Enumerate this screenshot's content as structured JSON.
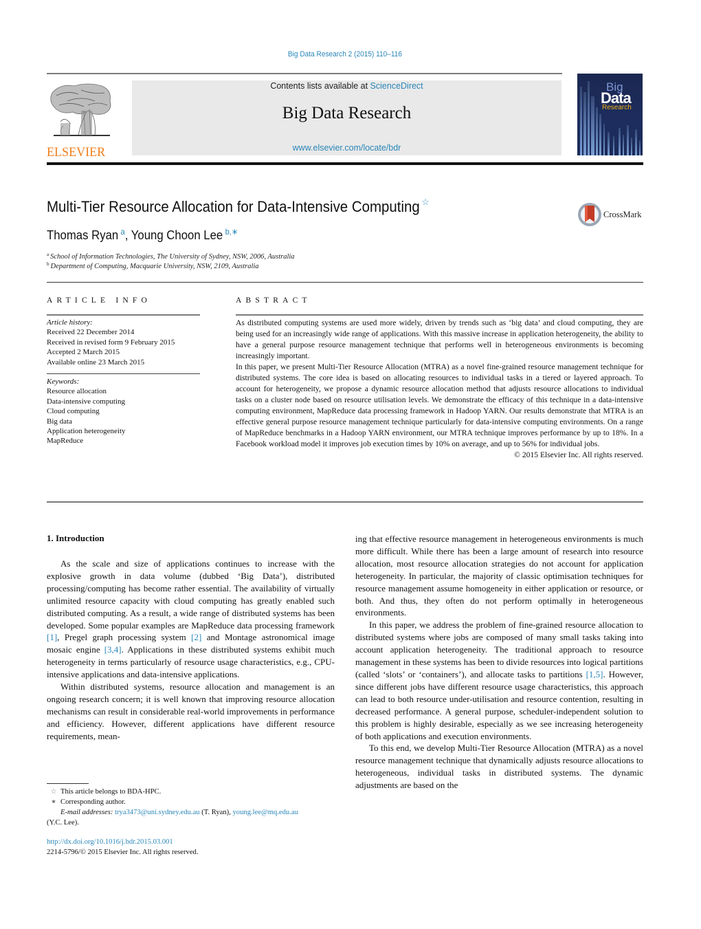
{
  "header": {
    "journal_ref": "Big Data Research 2 (2015) 110–116",
    "contents_prefix": "Contents lists available at ",
    "contents_link": "ScienceDirect",
    "journal_title": "Big Data Research",
    "journal_url": "www.elsevier.com/locate/bdr",
    "publisher_logo_text": "ELSEVIER",
    "cover": {
      "big": "Big",
      "data": "Data",
      "research": "Research"
    },
    "colors": {
      "link": "#2a86b8",
      "elsevier_orange": "#f07e1b",
      "masthead_bg": "#e9e9e9",
      "cover_bg": "#1b2850",
      "cover_accent": "#f2b21a"
    }
  },
  "article": {
    "title": "Multi-Tier Resource Allocation for Data-Intensive Computing",
    "title_note_mark": "☆",
    "crossmark_label": "CrossMark",
    "authors": [
      {
        "name": "Thomas Ryan",
        "sup": "a"
      },
      {
        "name": "Young Choon Lee",
        "sup": "b,∗"
      }
    ],
    "author_separator": ", ",
    "affiliations": [
      {
        "mark": "a",
        "text": "School of Information Technologies, The University of Sydney, NSW, 2006, Australia"
      },
      {
        "mark": "b",
        "text": "Department of Computing, Macquarie University, NSW, 2109, Australia"
      }
    ]
  },
  "article_info": {
    "heading": "ARTICLE INFO",
    "history_label": "Article history:",
    "history": [
      "Received 22 December 2014",
      "Received in revised form 9 February 2015",
      "Accepted 2 March 2015",
      "Available online 23 March 2015"
    ],
    "keywords_label": "Keywords:",
    "keywords": [
      "Resource allocation",
      "Data-intensive computing",
      "Cloud computing",
      "Big data",
      "Application heterogeneity",
      "MapReduce"
    ]
  },
  "abstract": {
    "heading": "ABSTRACT",
    "paragraphs": [
      "As distributed computing systems are used more widely, driven by trends such as ‘big data’ and cloud computing, they are being used for an increasingly wide range of applications. With this massive increase in application heterogeneity, the ability to have a general purpose resource management technique that performs well in heterogeneous environments is becoming increasingly important.",
      "In this paper, we present Multi-Tier Resource Allocation (MTRA) as a novel fine-grained resource management technique for distributed systems. The core idea is based on allocating resources to individual tasks in a tiered or layered approach. To account for heterogeneity, we propose a dynamic resource allocation method that adjusts resource allocations to individual tasks on a cluster node based on resource utilisation levels. We demonstrate the efficacy of this technique in a data-intensive computing environment, MapReduce data processing framework in Hadoop YARN. Our results demonstrate that MTRA is an effective general purpose resource management technique particularly for data-intensive computing environments. On a range of MapReduce benchmarks in a Hadoop YARN environment, our MTRA technique improves performance by up to 18%. In a Facebook workload model it improves job execution times by 10% on average, and up to 56% for individual jobs."
    ],
    "copyright": "© 2015 Elsevier Inc. All rights reserved."
  },
  "body": {
    "section_heading": "1.  Introduction",
    "left": [
      {
        "parts": [
          {
            "t": "As the scale and size of applications continues to increase with the explosive growth in data volume (dubbed ‘Big Data’), distributed processing/computing has become rather essential. The availability of virtually unlimited resource capacity with cloud computing has greatly enabled such distributed computing. As a result, a wide range of distributed systems has been developed. Some popular examples are MapReduce data processing framework "
          },
          {
            "ref": "[1]"
          },
          {
            "t": ", Pregel graph processing system "
          },
          {
            "ref": "[2]"
          },
          {
            "t": " and Montage astronomical image mosaic engine "
          },
          {
            "ref": "[3,4]"
          },
          {
            "t": ". Applications in these distributed systems exhibit much heterogeneity in terms particularly of resource usage characteristics, e.g., CPU-intensive applications and data-intensive applications."
          }
        ]
      },
      {
        "parts": [
          {
            "t": "Within distributed systems, resource allocation and management is an ongoing research concern; it is well known that improving resource allocation mechanisms can result in considerable real-world improvements in performance and efficiency. However, different applications have different resource requirements, mean-"
          }
        ]
      }
    ],
    "right": [
      {
        "noindent": true,
        "parts": [
          {
            "t": "ing that effective resource management in heterogeneous environments is much more difficult. While there has been a large amount of research into resource allocation, most resource allocation strategies do not account for application heterogeneity. In particular, the majority of classic optimisation techniques for resource management assume homogeneity in either application or resource, or both. And thus, they often do not perform optimally in heterogeneous environments."
          }
        ]
      },
      {
        "parts": [
          {
            "t": "In this paper, we address the problem of fine-grained resource allocation to distributed systems where jobs are composed of many small tasks taking into account application heterogeneity. The traditional approach to resource management in these systems has been to divide resources into logical partitions (called ‘slots’ or ‘containers’), and allocate tasks to partitions "
          },
          {
            "ref": "[1,5]"
          },
          {
            "t": ". However, since different jobs have different resource usage characteristics, this approach can lead to both resource under-utilisation and resource contention, resulting in decreased performance. A general purpose, scheduler-independent solution to this problem is highly desirable, especially as we see increasing heterogeneity of both applications and execution environments."
          }
        ]
      },
      {
        "parts": [
          {
            "t": "To this end, we develop Multi-Tier Resource Allocation (MTRA) as a novel resource management technique that dynamically adjusts resource allocations to heterogeneous, individual tasks in distributed systems. The dynamic adjustments are based on the"
          }
        ]
      }
    ]
  },
  "footnotes": {
    "star_mark": "☆",
    "star_text": "This article belongs to BDA-HPC.",
    "corr_mark": "∗",
    "corr_text": "Corresponding author.",
    "email_label": "E-mail addresses:",
    "email1": "trya3473@uni.sydney.edu.au",
    "email1_owner": " (T. Ryan), ",
    "email2": "young.lee@mq.edu.au",
    "email2_owner": "(Y.C. Lee).",
    "doi": "http://dx.doi.org/10.1016/j.bdr.2015.03.001",
    "issn": "2214-5796/© 2015 Elsevier Inc. All rights reserved."
  }
}
